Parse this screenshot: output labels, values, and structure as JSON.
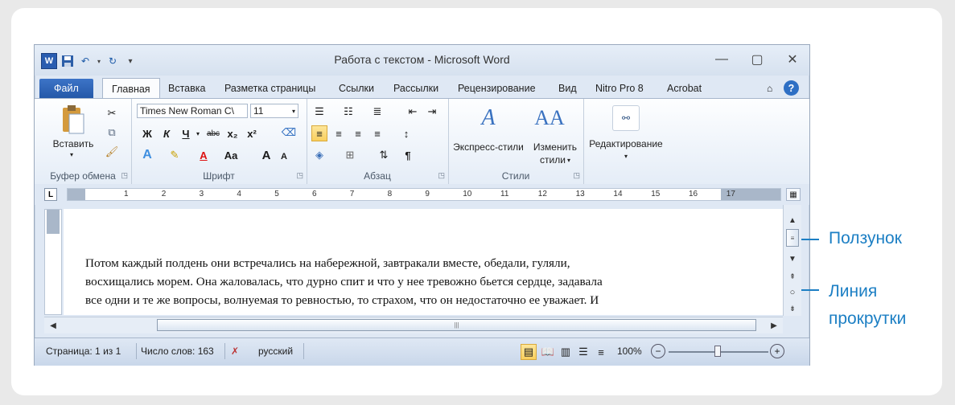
{
  "window": {
    "title": "Работа с текстом  -  Microsoft Word",
    "controls": [
      "minimize-icon",
      "maximize-icon",
      "close-icon"
    ]
  },
  "tabs": {
    "file": "Файл",
    "items": [
      "Главная",
      "Вставка",
      "Разметка страницы",
      "Ссылки",
      "Рассылки",
      "Рецензирование",
      "Вид",
      "Nitro Pro 8",
      "Acrobat"
    ]
  },
  "ribbon": {
    "clipboard": {
      "paste": "Вставить",
      "label": "Буфер обмена"
    },
    "font": {
      "name": "Times New Roman C\\",
      "size": "11",
      "label": "Шрифт",
      "bold": "Ж",
      "italic": "К",
      "underline": "Ч",
      "strike": "abc",
      "sub": "x₂",
      "sup": "x²",
      "grow": "A",
      "shrink": "A",
      "case": "Aa"
    },
    "paragraph": {
      "label": "Абзац",
      "pilcrow": "¶"
    },
    "styles": {
      "express": "Экспресс-стили",
      "change_line1": "Изменить",
      "change_line2": "стили",
      "label": "Стили"
    },
    "editing": {
      "label": "Редактирование"
    }
  },
  "ruler": {
    "numbers": [
      "1",
      "2",
      "3",
      "4",
      "5",
      "6",
      "7",
      "8",
      "9",
      "10",
      "11",
      "12",
      "13",
      "14",
      "15",
      "16",
      "17"
    ]
  },
  "document": {
    "lines": [
      "Потом каждый полдень они встречались на набережной, завтракали вместе, обедали, гуляли,",
      "восхищались морем. Она жаловалась, что дурно спит и что у нее тревожно бьется сердце, задавала",
      "все одни и те же вопросы, волнуемая то ревностью, то страхом, что он недостаточно ее уважает. И"
    ]
  },
  "status": {
    "page": "Страница: 1 из 1",
    "words": "Число слов: 163",
    "language": "русский",
    "zoom": "100%"
  },
  "callouts": {
    "thumb": "Ползунок",
    "scroll_line1": "Линия",
    "scroll_line2": "прокрутки"
  },
  "colors": {
    "accent": "#1c7fc4",
    "file_tab": "#2b5fb0"
  }
}
